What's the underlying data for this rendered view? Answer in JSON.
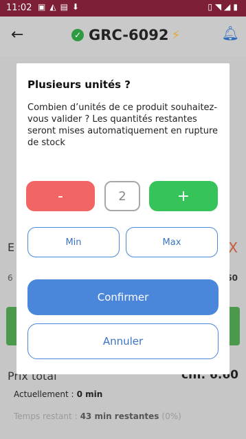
{
  "status_bar": {
    "time": "11:02",
    "left_icons": [
      "image-icon",
      "notification-icon",
      "sim-icon",
      "download-icon"
    ],
    "right_icons": [
      "vibrate-icon",
      "wifi-icon",
      "signal-icon",
      "battery-icon"
    ]
  },
  "app_bar": {
    "title": "GRC-6092",
    "status_color": "#2e9a42",
    "bolt_color": "#e7a732"
  },
  "background": {
    "row1_label": "E",
    "row2_left": "6",
    "row2_right": "60",
    "prix_label": "Prix total",
    "prix_value": "chf. 6.60",
    "actuellement_label": "Actuellement :",
    "actuellement_value": "0 min",
    "temps_label": "Temps restant :",
    "temps_value": "43 min restantes",
    "temps_percent": "(0%)"
  },
  "dialog": {
    "title": "Plusieurs unités ?",
    "message": "Combien d’unités de ce produit souhaitez-vous valider ? Les quantités restantes seront mises automatiquement en rupture de stock",
    "minus_label": "-",
    "quantity": "2",
    "plus_label": "+",
    "min_label": "Min",
    "max_label": "Max",
    "confirm_label": "Confirmer",
    "cancel_label": "Annuler",
    "colors": {
      "minus": "#f26565",
      "plus": "#36c35a",
      "primary": "#4a86d9"
    }
  }
}
